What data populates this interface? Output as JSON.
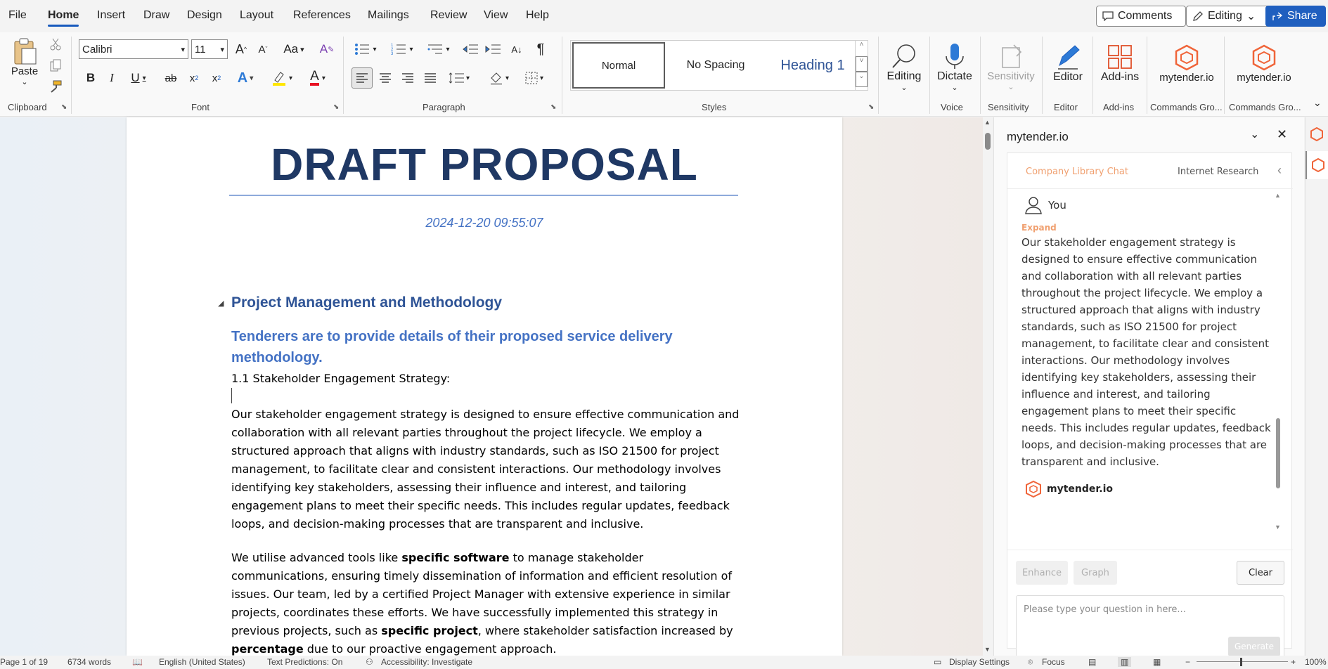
{
  "menu": [
    "File",
    "Home",
    "Insert",
    "Draw",
    "Design",
    "Layout",
    "References",
    "Mailings",
    "Review",
    "View",
    "Help"
  ],
  "top_buttons": {
    "comments": "Comments",
    "editing": "Editing",
    "share": "Share"
  },
  "ribbon": {
    "clipboard": {
      "paste": "Paste",
      "label": "Clipboard"
    },
    "font": {
      "name": "Calibri",
      "size": "11",
      "label": "Font",
      "case_label": "Aa"
    },
    "paragraph": {
      "label": "Paragraph"
    },
    "styles": {
      "normal": "Normal",
      "no_spacing": "No Spacing",
      "heading1": "Heading 1",
      "label": "Styles"
    },
    "editing": {
      "label": "Editing"
    },
    "voice": {
      "dictate": "Dictate",
      "label": "Voice"
    },
    "sensitivity": {
      "button": "Sensitivity",
      "label": "Sensitivity"
    },
    "editor": {
      "button": "Editor",
      "label": "Editor"
    },
    "addins": {
      "button": "Add-ins",
      "label": "Add-ins"
    },
    "mytender1": {
      "button": "mytender.io",
      "label": "Commands Gro..."
    },
    "mytender2": {
      "button": "mytender.io",
      "label": "Commands Gro..."
    }
  },
  "document": {
    "title": "DRAFT PROPOSAL",
    "date": "2024-12-20 09:55:07",
    "heading1": "Project Management and Methodology",
    "heading2": "Tenderers are to provide details of their proposed service delivery methodology.",
    "section": "1.1 Stakeholder Engagement Strategy:",
    "para1": "Our stakeholder engagement strategy is designed to ensure effective communication and collaboration with all relevant parties throughout the project lifecycle. We employ a structured approach that aligns with industry standards, such as ISO 21500 for project management, to facilitate clear and consistent interactions. Our methodology involves identifying key stakeholders, assessing their influence and interest, and tailoring engagement plans to meet their specific needs. This includes regular updates, feedback loops, and decision-making processes that are transparent and inclusive.",
    "para2": {
      "t1": "We utilise advanced tools like ",
      "b1": "specific software",
      "t2": " to manage stakeholder communications, ensuring timely dissemination of information and efficient resolution of issues. Our team, led by a certified Project Manager with extensive experience in similar projects, coordinates these efforts. We have successfully implemented this strategy in previous projects, such as ",
      "b2": "specific project",
      "t3": ", where stakeholder satisfaction increased by ",
      "b3": "percentage",
      "t4": " due to our proactive engagement approach."
    }
  },
  "pane": {
    "title": "mytender.io",
    "tabs": [
      "Company Library Chat",
      "Internet Research"
    ],
    "user": "You",
    "expand": "Expand",
    "message": "Our stakeholder engagement strategy is designed to ensure effective communication and collaboration with all relevant parties throughout the project lifecycle. We employ a structured approach that aligns with industry standards, such as ISO 21500 for project management, to facilitate clear and consistent interactions. Our methodology involves identifying key stakeholders, assessing their influence and interest, and tailoring engagement plans to meet their specific needs. This includes regular updates, feedback loops, and decision-making processes that are transparent and inclusive.",
    "bot": "mytender.io",
    "enhance": "Enhance",
    "graph": "Graph",
    "clear": "Clear",
    "placeholder": "Please type your question in here...",
    "generate": "Generate"
  },
  "status": {
    "page": "Page 1 of 19",
    "words": "6734 words",
    "language": "English (United States)",
    "predictions": "Text Predictions: On",
    "accessibility": "Accessibility: Investigate",
    "display": "Display Settings",
    "focus": "Focus",
    "zoom": "100%"
  },
  "colors": {
    "accent": "#185abd",
    "title": "#1f3864",
    "heading": "#2f5496",
    "brand_orange": "#f0653a"
  }
}
